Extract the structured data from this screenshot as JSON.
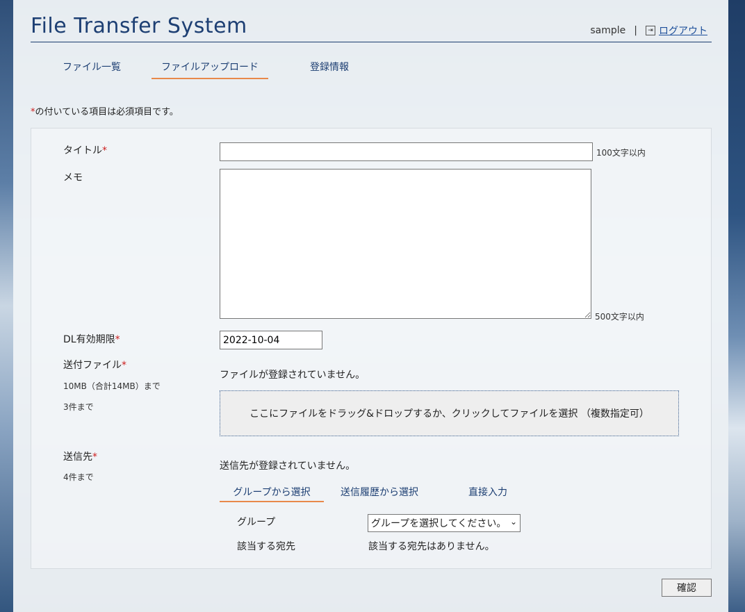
{
  "header": {
    "title": "File Transfer System",
    "username": "sample",
    "separator": "|",
    "logout_label": "ログアウト"
  },
  "tabs": [
    {
      "label": "ファイル一覧",
      "active": false
    },
    {
      "label": "ファイルアップロード",
      "active": true
    },
    {
      "label": "登録情報",
      "active": false
    }
  ],
  "form": {
    "required_mark": "*",
    "required_note": "の付いている項目は必須項目です。",
    "title_field": {
      "label": "タイトル",
      "value": "",
      "limit_hint": "100文字以内"
    },
    "memo_field": {
      "label": "メモ",
      "value": "",
      "limit_hint": "500文字以内"
    },
    "expiry_field": {
      "label": "DL有効期限",
      "value": "2022-10-04"
    },
    "files": {
      "label": "送付ファイル",
      "size_limit": "10MB（合計14MB）まで",
      "count_limit": "3件まで",
      "empty_message": "ファイルが登録されていません。",
      "dropzone_text": "ここにファイルをドラッグ&ドロップするか、クリックしてファイルを選択 （複数指定可）"
    },
    "recipients": {
      "label": "送信先",
      "count_limit": "4件まで",
      "empty_message": "送信先が登録されていません。",
      "tabs": [
        {
          "label": "グループから選択",
          "active": true
        },
        {
          "label": "送信履歴から選択",
          "active": false
        },
        {
          "label": "直接入力",
          "active": false
        }
      ],
      "group_label": "グループ",
      "group_select_value": "グループを選択してください。",
      "match_label": "該当する宛先",
      "match_value": "該当する宛先はありません。"
    }
  },
  "confirm_label": "確認",
  "colors": {
    "accent": "#e8884a",
    "title": "#1d3f73",
    "link": "#1d4f9a",
    "required": "#cc1d1d"
  }
}
